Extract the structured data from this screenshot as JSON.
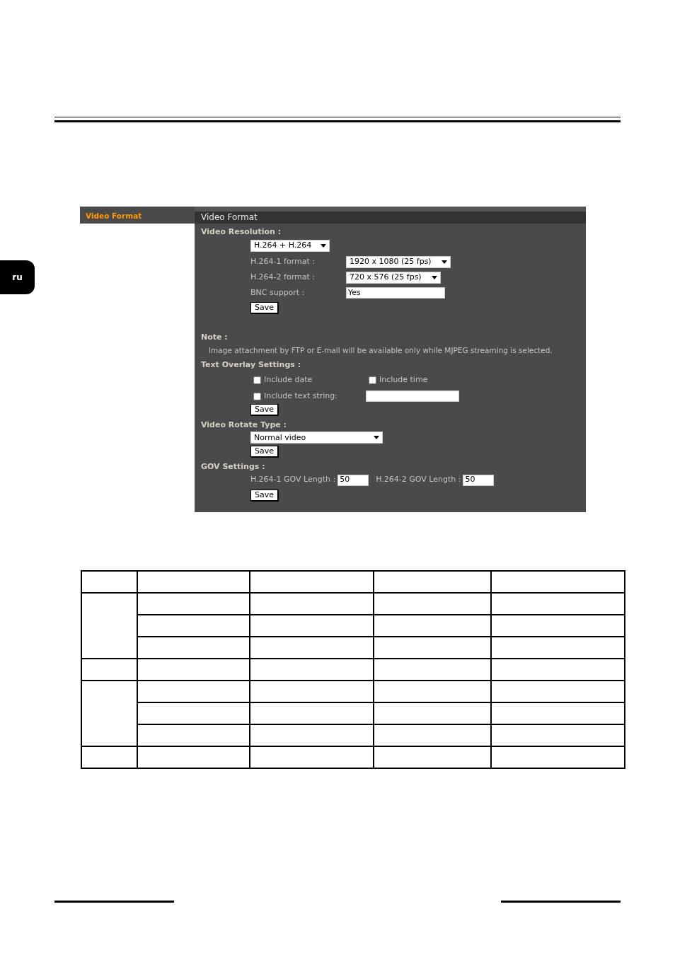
{
  "side_tab": "ru",
  "sidebar": {
    "items": [
      {
        "label": "Video Format",
        "selected": true
      }
    ]
  },
  "title": "Video Format",
  "video_resolution": {
    "heading": "Video Resolution :",
    "mode_select": "H.264 + H.264",
    "fields": [
      {
        "kind": "select",
        "label": "H.264-1 format :",
        "value": "1920 x 1080 (25 fps)"
      },
      {
        "kind": "select",
        "label": "H.264-2 format :",
        "value": "720 x 576 (25 fps)"
      },
      {
        "kind": "text",
        "label": "BNC support :",
        "value": "Yes"
      }
    ],
    "save": "Save"
  },
  "note": {
    "heading": "Note :",
    "text": "Image attachment by FTP or E-mail will be available only while MJPEG streaming is selected."
  },
  "text_overlay": {
    "heading": "Text Overlay Settings :",
    "options": [
      {
        "label": "Include date",
        "checked": false
      },
      {
        "label": "Include time",
        "checked": false
      },
      {
        "label": "Include text string:",
        "checked": false
      }
    ],
    "save": "Save"
  },
  "rotate": {
    "heading": "Video Rotate Type :",
    "value": "Normal video",
    "save": "Save"
  },
  "gov": {
    "heading": "GOV Settings :",
    "fields": [
      {
        "label": "H.264-1 GOV Length :",
        "value": "50"
      },
      {
        "label": "H.264-2 GOV Length :",
        "value": "50"
      }
    ],
    "save": "Save"
  }
}
